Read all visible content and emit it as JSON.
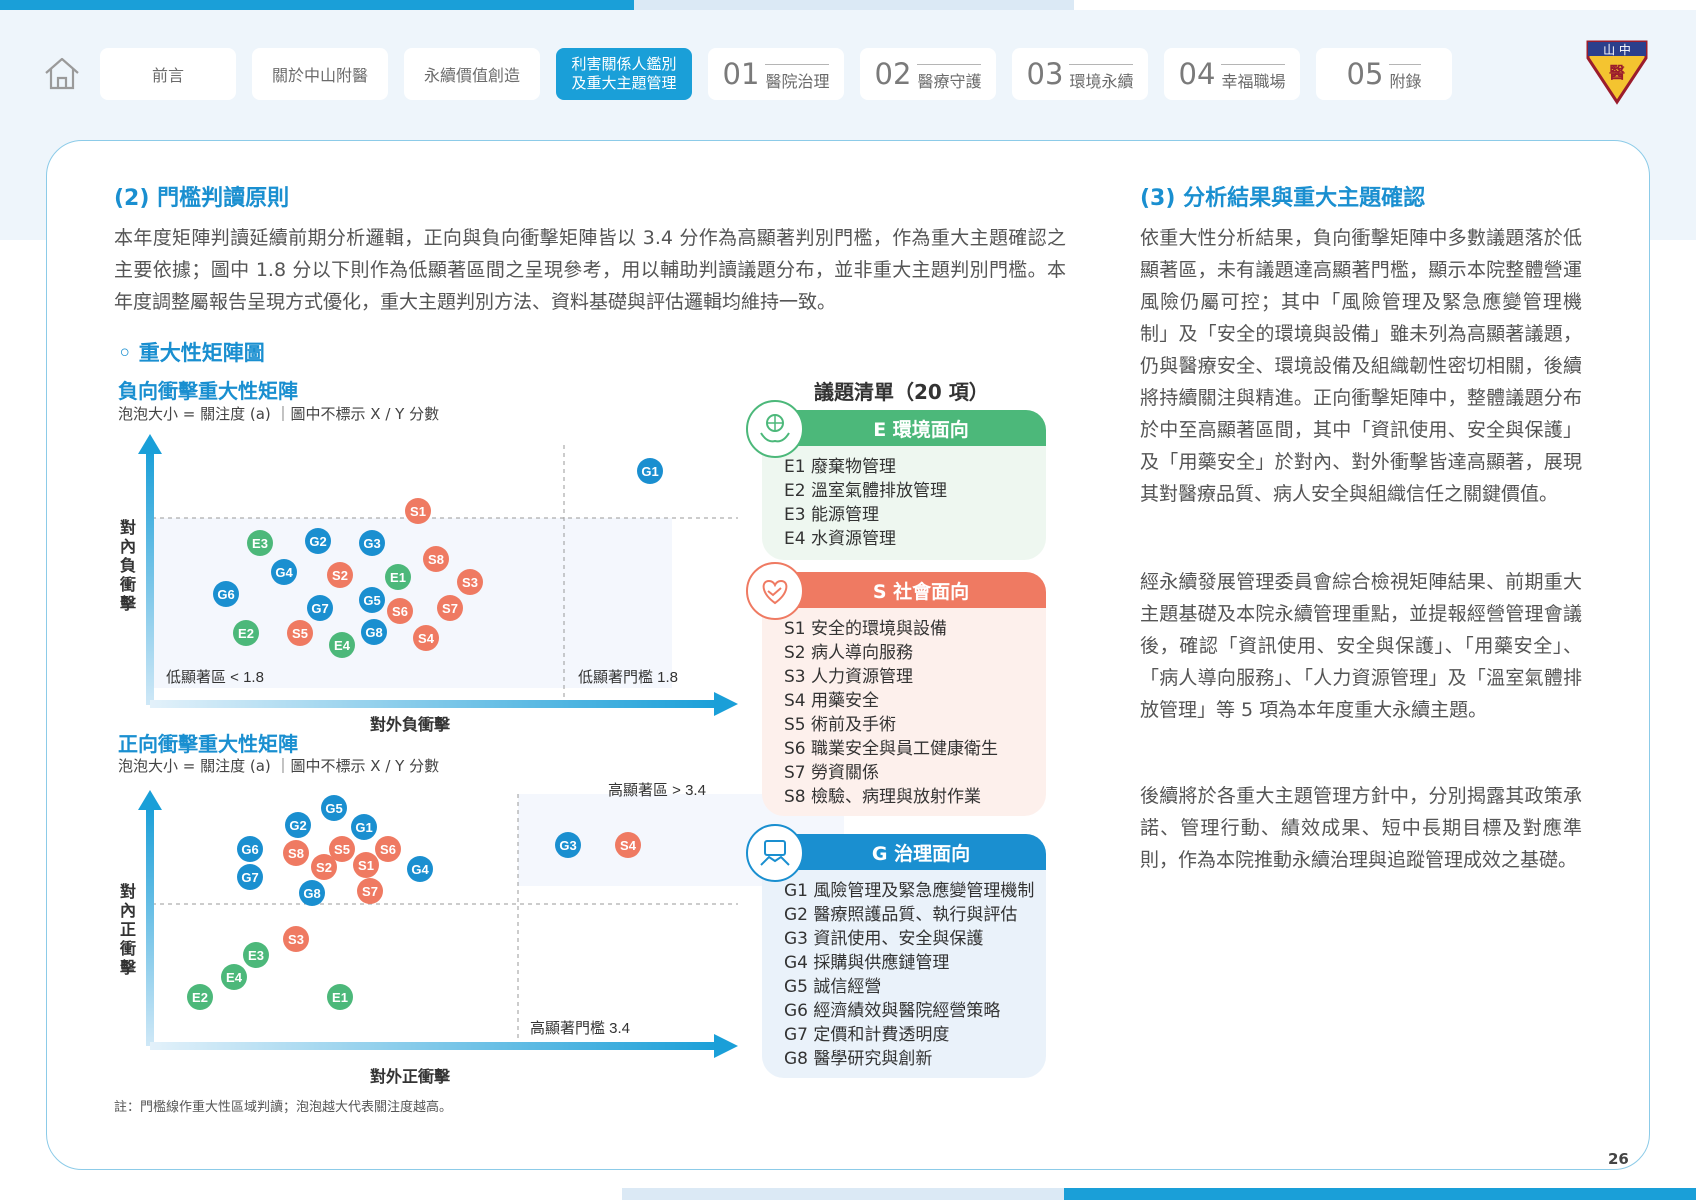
{
  "nav": {
    "buttons": [
      {
        "label": "前言"
      },
      {
        "label": "關於中山附醫"
      },
      {
        "label": "永續價值創造"
      },
      {
        "line1": "利害關係人鑑別",
        "line2": "及重大主題管理"
      },
      {
        "num": "01",
        "label": "醫院治理"
      },
      {
        "num": "02",
        "label": "醫療守護"
      },
      {
        "num": "03",
        "label": "環境永續"
      },
      {
        "num": "04",
        "label": "幸福職場"
      },
      {
        "num": "05",
        "label": "附錄"
      }
    ],
    "logo_text_top": "山 中",
    "logo_text_mid": "醫"
  },
  "section2": {
    "title": "(2) 門檻判讀原則",
    "body": "本年度矩陣判讀延續前期分析邏輯，正向與負向衝擊矩陣皆以 3.4 分作為高顯著判別門檻，作為重大主題確認之主要依據；圖中 1.8 分以下則作為低顯著區間之呈現參考，用以輔助判讀議題分布，並非重大主題判別門檻。本年度調整屬報告呈現方式優化，重大主題判別方法、資料基礎與評估邏輯均維持一致。",
    "bullet": "◦  重大性矩陣圖"
  },
  "neg_matrix": {
    "title": "負向衝擊重大性矩陣",
    "subtitle": "泡泡大小 = 關注度 (a) ｜圖中不標示 X / Y 分數",
    "y_label": "對內負衝擊",
    "x_label": "對外負衝擊",
    "low_zone_label": "低顯著區 < 1.8",
    "threshold_label": "低顯著門檻 1.8"
  },
  "pos_matrix": {
    "title": "正向衝擊重大性矩陣",
    "subtitle": "泡泡大小 = 關注度 (a) ｜圖中不標示 X / Y 分數",
    "y_label": "對內正衝擊",
    "x_label": "對外正衝擊",
    "high_zone_label": "高顯著區 > 3.4",
    "threshold_label": "高顯著門檻 3.4"
  },
  "note": "註：門檻線作重大性區域判讀；泡泡越大代表關注度越高。",
  "topic_list": {
    "title": "議題清單（20 項）",
    "categories": [
      {
        "name": "E 環境面向",
        "color": "#4cb87a",
        "bg": "#eef7f0",
        "items": [
          "E1 廢棄物管理",
          "E2 溫室氣體排放管理",
          "E3 能源管理",
          "E4 水資源管理"
        ]
      },
      {
        "name": "S 社會面向",
        "color": "#ef7a62",
        "bg": "#fdf0ec",
        "items": [
          "S1 安全的環境與設備",
          "S2 病人導向服務",
          "S3 人力資源管理",
          "S4 用藥安全",
          "S5 術前及手術",
          "S6 職業安全與員工健康衛生",
          "S7 勞資關係",
          "S8 檢驗、病理與放射作業"
        ]
      },
      {
        "name": "G 治理面向",
        "color": "#1a8fd0",
        "bg": "#eaf2fa",
        "items": [
          "G1 風險管理及緊急應變管理機制",
          "G2 醫療照護品質、執行與評估",
          "G3 資訊使用、安全與保護",
          "G4 採購與供應鏈管理",
          "G5 誠信經營",
          "G6 經濟績效與醫院經營策略",
          "G7 定價和計費透明度",
          "G8 醫學研究與創新"
        ]
      }
    ]
  },
  "section3": {
    "title": "(3) 分析結果與重大主題確認",
    "p1": "依重大性分析結果，負向衝擊矩陣中多數議題落於低顯著區，未有議題達高顯著門檻，顯示本院整體營運風險仍屬可控；其中「風險管理及緊急應變管理機制」及「安全的環境與設備」雖未列為高顯著議題，仍與醫療安全、環境設備及組織韌性密切相關，後續將持續關注與精進。正向衝擊矩陣中，整體議題分布於中至高顯著區間，其中「資訊使用、安全與保護」及「用藥安全」於對內、對外衝擊皆達高顯著，展現其對醫療品質、病人安全與組織信任之關鍵價值。",
    "p2": "經永續發展管理委員會綜合檢視矩陣結果、前期重大主題基礎及本院永續管理重點，並提報經營管理會議後，確認「資訊使用、安全與保護」、「用藥安全」、「病人導向服務」、「人力資源管理」及「溫室氣體排放管理」等 5 項為本年度重大永續主題。",
    "p3": "後續將於各重大主題管理方針中，分別揭露其政策承諾、管理行動、績效成果、短中長期目標及對應準則，作為本院推動永續治理與追蹤管理成效之基礎。"
  },
  "page_number": "26",
  "colors": {
    "E": "#4cb87a",
    "S": "#ef7a62",
    "G": "#1a8fd0",
    "accent": "#1a9fd8"
  }
}
